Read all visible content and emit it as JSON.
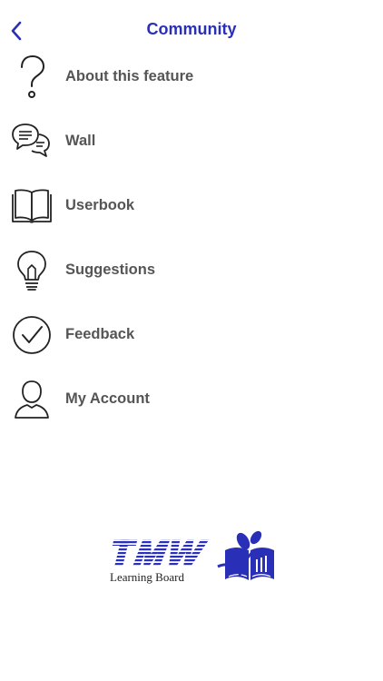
{
  "header": {
    "title": "Community",
    "back_icon": "chevron-left-icon"
  },
  "menu": {
    "items": [
      {
        "label": "About this feature",
        "icon": "question-mark-icon"
      },
      {
        "label": "Wall",
        "icon": "chat-bubbles-icon"
      },
      {
        "label": "Userbook",
        "icon": "open-book-icon"
      },
      {
        "label": "Suggestions",
        "icon": "lightbulb-icon"
      },
      {
        "label": "Feedback",
        "icon": "check-circle-icon"
      },
      {
        "label": "My Account",
        "icon": "user-icon"
      }
    ]
  },
  "logo": {
    "wordmark": "TMW",
    "tagline": "Learning Board",
    "colors": {
      "primary": "#2a2fb8",
      "text": "#222222"
    }
  },
  "colors": {
    "accent": "#2a2fb8",
    "label": "#555555",
    "icon_stroke": "#222222"
  }
}
